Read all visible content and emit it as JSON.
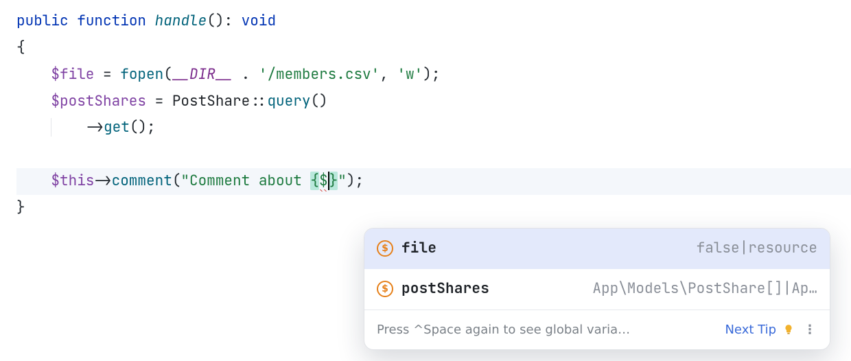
{
  "code": {
    "l1": {
      "public": "public",
      "function": "function",
      "name": "handle",
      "parens": "()",
      "colon": ":",
      "void": "void"
    },
    "l2": {
      "brace": "{"
    },
    "l3": {
      "var": "$file",
      "eq": " = ",
      "fn": "fopen",
      "op": "(",
      "magic": "__DIR__",
      "cat": " . ",
      "s1": "'/members.csv'",
      "comma": ", ",
      "s2": "'w'",
      "close": ");"
    },
    "l4": {
      "var": "$postShares",
      "eq": " = ",
      "cls": "PostShare",
      "scope": "::",
      "fn": "query",
      "close": "()"
    },
    "l5": {
      "arrow": "->",
      "fn": "get",
      "close": "();"
    },
    "l6": {
      "blank": ""
    },
    "l7": {
      "var": "$this",
      "arrow": "->",
      "fn": "comment",
      "open": "(",
      "s_open": "\"Comment about ",
      "intp_open": "{",
      "dollar": "$",
      "intp_close": "}",
      "s_close": "\"",
      "close": ");"
    },
    "l8": {
      "brace": "}"
    }
  },
  "autocomplete": {
    "items": [
      {
        "name": "file",
        "type": "false|resource",
        "selected": true
      },
      {
        "name": "postShares",
        "type": "App\\Models\\PostShare[]|Ap…",
        "selected": false
      }
    ],
    "footer_hint": "Press ^Space again to see global varia…",
    "next_tip": "Next Tip"
  },
  "icons": {
    "coin_glyph": "$",
    "dots": "⋮"
  }
}
